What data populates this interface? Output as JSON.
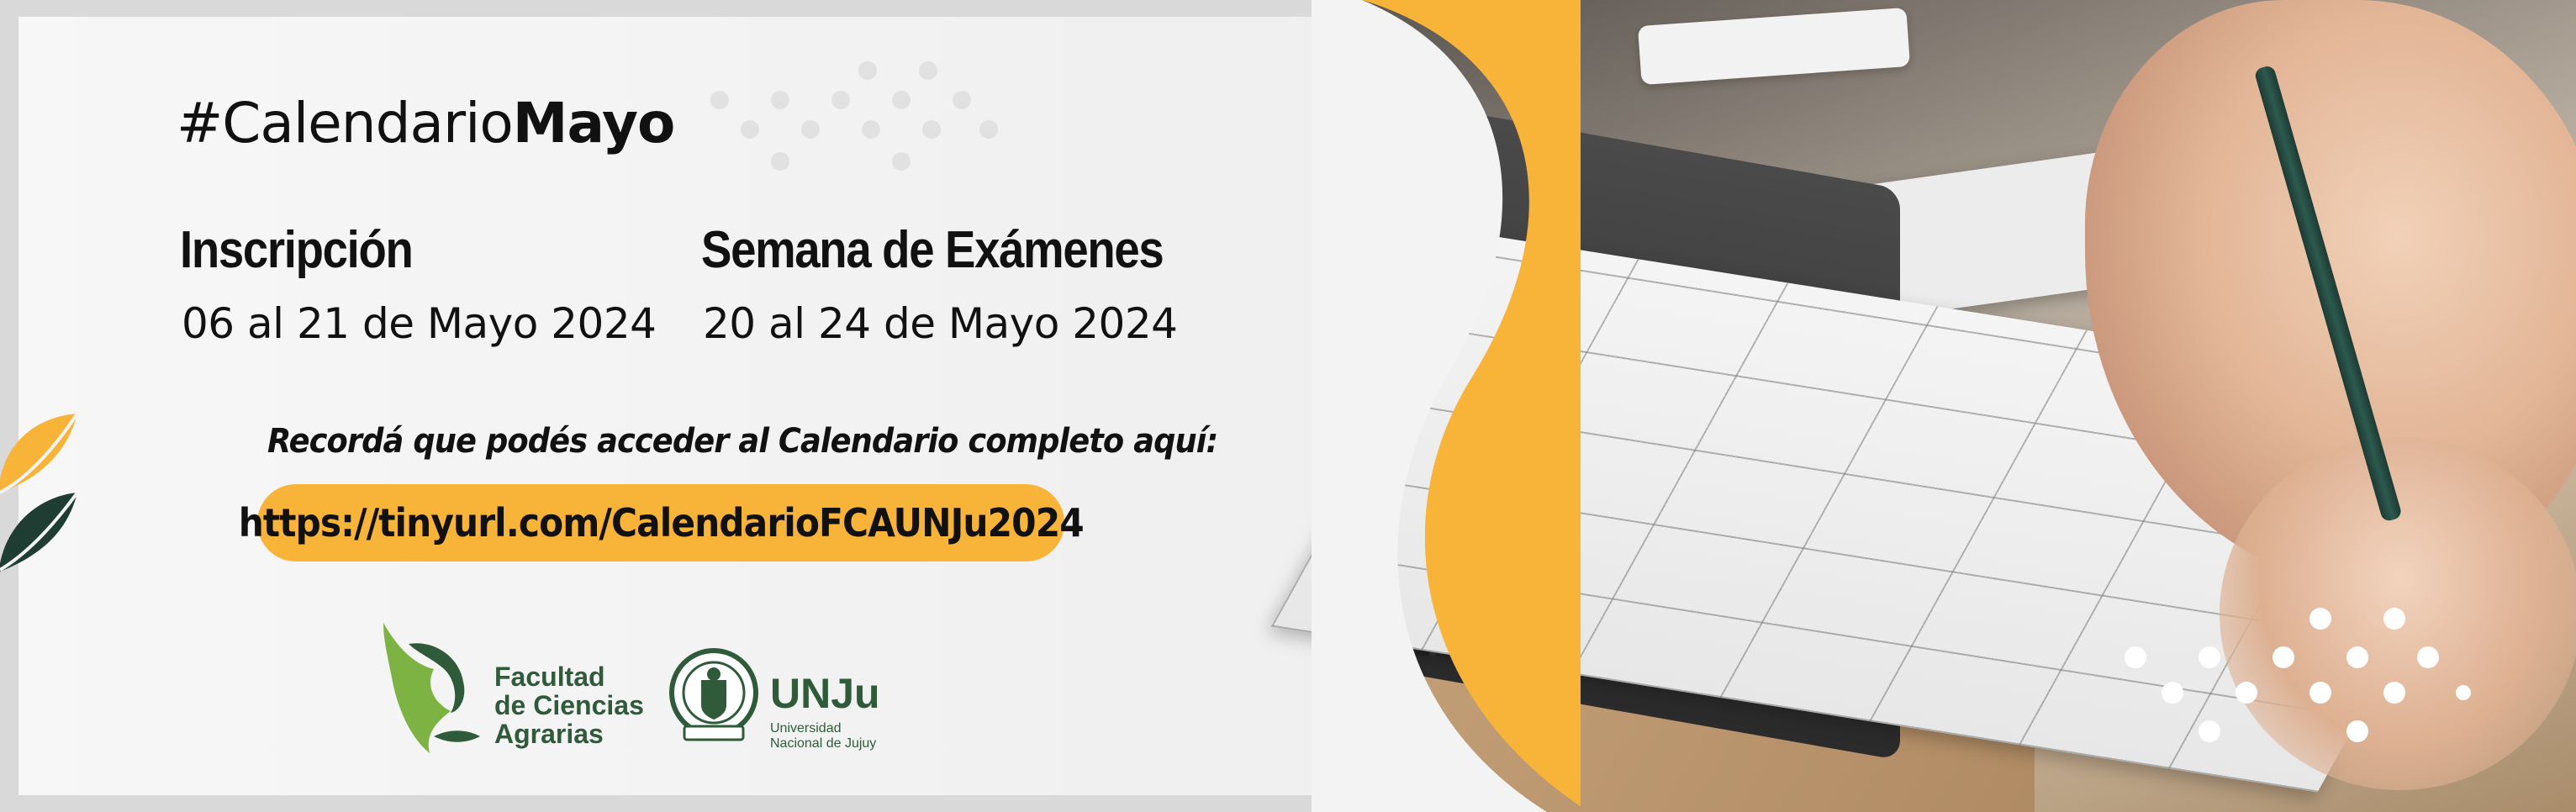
{
  "banner": {
    "hashtag_prefix": "#Calendario",
    "hashtag_month": "Mayo",
    "inscription": {
      "title": "Inscripción",
      "dates": "06 al 21 de Mayo 2024"
    },
    "exams": {
      "title": "Semana de Exámenes",
      "dates": "20 al 24 de Mayo 2024"
    },
    "reminder": "Recordá que podés acceder al Calendario completo aquí:",
    "link": "https://tinyurl.com/CalendarioFCAUNJu2024"
  },
  "logos": {
    "faculty_line1": "Facultad",
    "faculty_line2": "de Ciencias",
    "faculty_line3": "Agrarias",
    "university_abbr": "UNJu",
    "university_line1": "Universidad",
    "university_line2": "Nacional de Jujuy"
  },
  "colors": {
    "accent_yellow": "#f8b339",
    "brand_green": "#2f5b3a",
    "panel_bg": "#f2f2f2",
    "border_gray": "#d9d9d9"
  },
  "icons": {
    "faculty_logo": "leaf-head-icon",
    "university_seal": "seal-icon",
    "decor_leaf": "leaf-icon"
  }
}
